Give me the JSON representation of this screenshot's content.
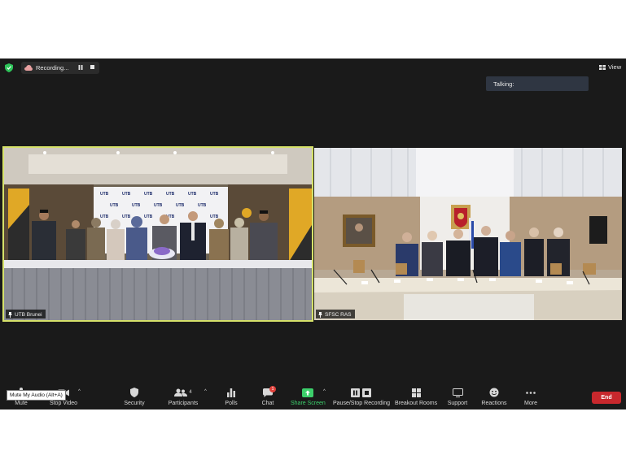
{
  "topbar": {
    "recording_label": "Recording...",
    "view_label": "View",
    "talking_label": "Talking:"
  },
  "videos": [
    {
      "name": "UTB Brunei",
      "banner_text": "UTB",
      "highlighted": true
    },
    {
      "name": "SFSC RAS",
      "highlighted": false
    }
  ],
  "toolbar": {
    "tooltip": "Mute My Audio (Alt+A)",
    "mute": "Mute",
    "stop_video": "Stop Video",
    "security": "Security",
    "participants": "Participants",
    "participants_count": "4",
    "polls": "Polls",
    "chat": "Chat",
    "chat_badge": "1",
    "share_screen": "Share Screen",
    "pause_stop_recording": "Pause/Stop Recording",
    "breakout_rooms": "Breakout Rooms",
    "support": "Support",
    "reactions": "Reactions",
    "more": "More",
    "end": "End"
  },
  "colors": {
    "background": "#1a1a1a",
    "active_speaker_border": "#d6e26a",
    "share_green": "#3ccf6b",
    "end_red": "#c8282d",
    "talking_bg": "#2f3642"
  }
}
